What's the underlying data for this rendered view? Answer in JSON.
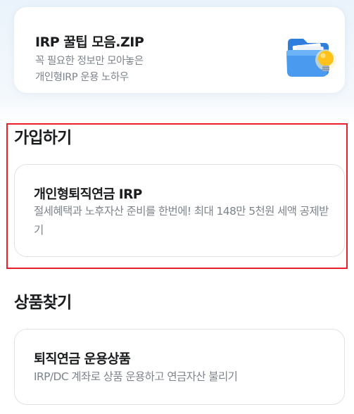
{
  "tips_card": {
    "title": "IRP 꿀팁 모음.ZIP",
    "desc_line1": "꼭 필요한 정보만 모아놓은",
    "desc_line2": "개인형IRP 운용 노하우",
    "icon": "folder-lightbulb-icon"
  },
  "join_section": {
    "title": "가입하기",
    "card": {
      "title": "개인형퇴직연금 IRP",
      "desc": "절세혜택과 노후자산 준비를 한번에! 최대 148만 5천원 세액 공제받기"
    }
  },
  "products_section": {
    "title": "상품찾기",
    "card": {
      "title": "퇴직연금 운용상품",
      "desc": "IRP/DC 계좌로 상품 운용하고 연금자산 불리기"
    }
  },
  "colors": {
    "highlight_border": "#e8202a",
    "title_text": "#1b1d1f",
    "desc_text": "#7d838b",
    "card_border": "#dfe3e8",
    "folder_blue": "#3a8de8",
    "bulb_yellow": "#ffc21c"
  }
}
